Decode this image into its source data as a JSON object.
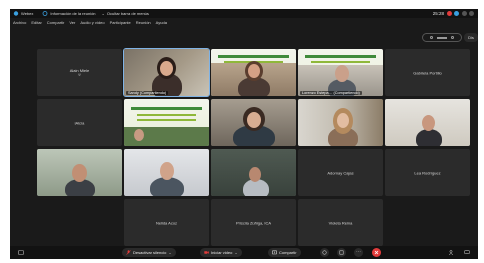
{
  "titlebar": {
    "app_name": "Webex",
    "tab_meeting_info": "Información de la reunión",
    "tab_hide_bar": "Ocultar barra de menús",
    "clock": "25:28"
  },
  "menu": [
    "Archivo",
    "Editar",
    "Compartir",
    "Ver",
    "Audio y vídeo",
    "Participante",
    "Reunión",
    "Ayuda"
  ],
  "view_button_label": "Dis",
  "participants": {
    "r1c1": {
      "name": "Alain Miele",
      "sub": "Ψ"
    },
    "r1c2": {
      "caption": "Sandy (Compartiendo)"
    },
    "r1c4": {
      "caption": "Lorenzo Estepa… (Compartiendo)"
    },
    "r1c5": {
      "name": "Gabriela Portillo"
    },
    "r2c1": {
      "name": "iAlcía"
    },
    "r3c4": {
      "name": "Adornay Cajas"
    },
    "r3c5": {
      "name": "Lea Rodríguez"
    },
    "r4c2": {
      "name": "Nelida Acoz"
    },
    "r4c3": {
      "name": "Priscila Zúñiga, ICA"
    },
    "r4c4": {
      "name": "Violeta Reina"
    }
  },
  "toolbar": {
    "mute_label": "Desactivar silencio",
    "video_label": "Iniciar video",
    "share_label": "Compartir"
  },
  "colors": {
    "background": "#1a1a1a",
    "tile": "#2b2b2b",
    "active_border": "#7fb3e6",
    "leave": "#e23b3b",
    "mute_icon": "#e23b3b"
  }
}
